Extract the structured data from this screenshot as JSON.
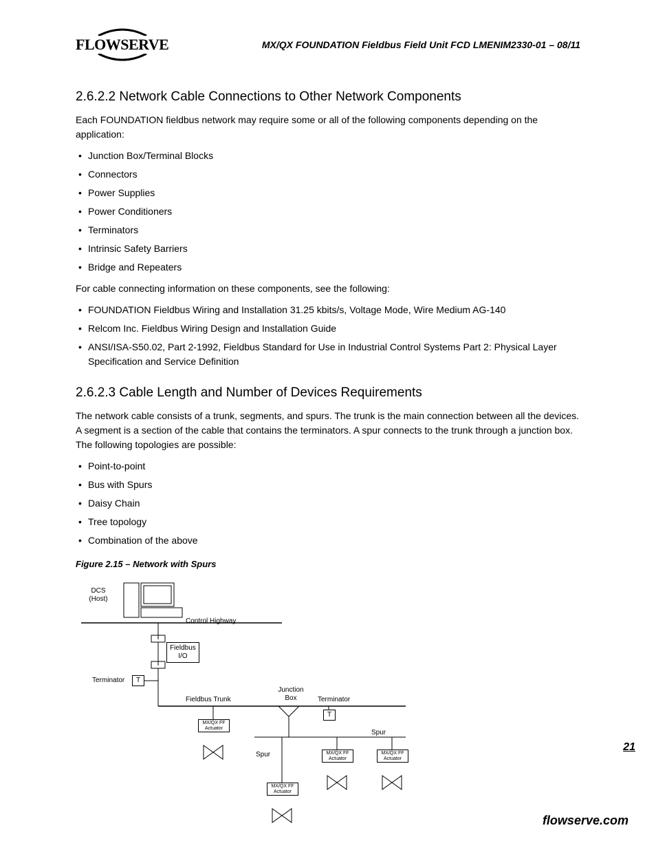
{
  "header": {
    "logo_text": "FLOWSERVE",
    "doc_title": "MX/QX FOUNDATION Fieldbus Field Unit    FCD LMENIM2330-01 – 08/11"
  },
  "section1": {
    "heading": "2.6.2.2 Network Cable Connections to Other Network Components",
    "intro": "Each FOUNDATION fieldbus network may require some or all of the following components depending on the application:",
    "components": [
      "Junction Box/Terminal Blocks",
      "Connectors",
      "Power Supplies",
      "Power Conditioners",
      "Terminators",
      "Intrinsic Safety Barriers",
      "Bridge and Repeaters"
    ],
    "refs_intro": "For cable connecting information on these components, see the following:",
    "refs": [
      "FOUNDATION Fieldbus Wiring and Installation 31.25 kbits/s, Voltage Mode, Wire Medium AG-140",
      "Relcom Inc. Fieldbus Wiring Design and Installation Guide",
      "ANSI/ISA-S50.02, Part 2-1992, Fieldbus Standard for Use in Industrial Control Systems Part 2: Physical Layer Specification and Service Definition"
    ]
  },
  "section2": {
    "heading": "2.6.2.3 Cable Length and Number of Devices Requirements",
    "intro": "The network cable consists of a trunk, segments, and spurs. The trunk is the main connection between all the devices. A segment is a section of the cable that contains the terminators. A spur connects to the trunk through a junction box. The following topologies are possible:",
    "topologies": [
      "Point-to-point",
      "Bus with Spurs",
      "Daisy Chain",
      "Tree topology",
      "Combination of the above"
    ]
  },
  "figure": {
    "caption": "Figure 2.15 – Network with Spurs",
    "labels": {
      "dcs": "DCS\n(Host)",
      "control_highway": "Control Highway",
      "fieldbus_io": "Fieldbus\nI/O",
      "terminator_left": "Terminator",
      "t_box": "T",
      "fieldbus_trunk": "Fieldbus Trunk",
      "junction_box": "Junction\nBox",
      "terminator_right": "Terminator",
      "spur": "Spur",
      "actuator_top": "MX/QX FF",
      "actuator_bottom": "Actuator"
    }
  },
  "footer": {
    "page_number": "21",
    "url": "flowserve.com"
  }
}
